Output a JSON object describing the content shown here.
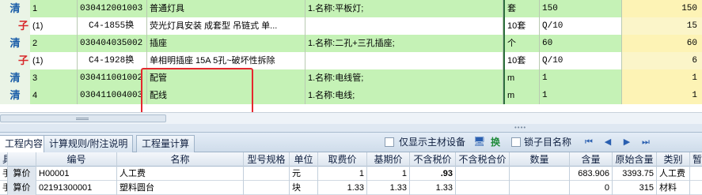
{
  "grid": {
    "rows": [
      {
        "type": "清",
        "idx": "1",
        "code": "030412001003",
        "name": "普通灯具",
        "feature": "1.名称:平板灯;",
        "unit": "套",
        "qty": "150",
        "value": "150",
        "style": "green",
        "kind": "clear"
      },
      {
        "type": "子",
        "idx": "(1)",
        "code": "C4-1855换",
        "name": "荧光灯具安装 成套型 吊链式 单...",
        "feature": "",
        "unit": "10套",
        "qty": "Q/10",
        "value": "15",
        "style": "white",
        "kind": "sub"
      },
      {
        "type": "清",
        "idx": "2",
        "code": "030404035002",
        "name": "插座",
        "feature": "1.名称:二孔+三孔插座;",
        "unit": "个",
        "qty": "60",
        "value": "60",
        "style": "green",
        "kind": "clear"
      },
      {
        "type": "子",
        "idx": "(1)",
        "code": "C4-1928换",
        "name": "单相明插座 15A 5孔~破坏性拆除",
        "feature": "",
        "unit": "10套",
        "qty": "Q/10",
        "value": "6",
        "style": "white",
        "kind": "sub"
      },
      {
        "type": "清",
        "idx": "3",
        "code": "030411001002",
        "name": "配管",
        "feature": "1.名称:电线管;",
        "unit": "m",
        "qty": "1",
        "value": "1",
        "style": "green",
        "kind": "clear"
      },
      {
        "type": "清",
        "idx": "4",
        "code": "030411004003",
        "name": "配线",
        "feature": "1.名称:电线;",
        "unit": "m",
        "qty": "1",
        "value": "1",
        "style": "green",
        "kind": "clear"
      }
    ]
  },
  "tabs": [
    {
      "label": "工程内容"
    },
    {
      "label": "计算规则/附注说明"
    },
    {
      "label": "工程量计算"
    }
  ],
  "toolbar": {
    "main_material_label": "仅显示主材设备",
    "swap_label": "换",
    "lock_label": "锁子目名称"
  },
  "bottom": {
    "headers": [
      "具",
      "",
      "编号",
      "名称",
      "型号规格",
      "单位",
      "取费价",
      "基期价",
      "不含税价",
      "不含税合价",
      "数量",
      "含量",
      "原始含量",
      "类别",
      "暂估"
    ],
    "rows": [
      [
        "手",
        "算价",
        "H00001",
        "人工费",
        "",
        "元",
        "1",
        "1",
        ".93",
        "",
        "",
        "683.906",
        "3393.75",
        "人工费",
        ""
      ],
      [
        "手",
        "算价",
        "02191300001",
        "塑料圆台",
        "",
        "块",
        "1.33",
        "1.33",
        "1.33",
        "",
        "",
        "0",
        "315",
        "材料",
        ""
      ]
    ]
  },
  "icons": {
    "clear": "清",
    "sub": "子",
    "nav": [
      "first-icon",
      "prev-icon",
      "next-icon",
      "last-icon"
    ]
  },
  "colors": {
    "row_green": "#c5f2b6",
    "value_col": "#fdf3b5",
    "highlight": "#e5282f",
    "sub_icon": "#d8282a",
    "clear_icon": "#1a5da8"
  }
}
